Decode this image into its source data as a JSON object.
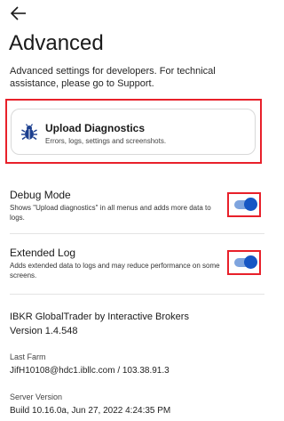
{
  "header": {
    "title": "Advanced",
    "subtitle": "Advanced settings for developers. For technical assistance, please go to Support."
  },
  "upload_card": {
    "title": "Upload Diagnostics",
    "description": "Errors, logs, settings and screenshots."
  },
  "settings": [
    {
      "title": "Debug Mode",
      "description": "Shows \"Upload diagnostics\" in all menus and adds more data to logs.",
      "enabled": true
    },
    {
      "title": "Extended Log",
      "description": "Adds extended data to logs and may reduce performance on some screens.",
      "enabled": true
    }
  ],
  "app_info": {
    "name": "IBKR GlobalTrader by Interactive Brokers",
    "version": "Version 1.4.548",
    "farm_label": "Last Farm",
    "farm_value": "JifH10108@hdc1.ibllc.com / 103.38.91.3",
    "server_label": "Server Version",
    "server_value": "Build 10.16.0a, Jun 27, 2022 4:24:35 PM"
  },
  "colors": {
    "toggle_on_knob": "#1656c4",
    "toggle_on_track": "#7ea4de",
    "highlight_box": "#e8202a",
    "icon_blue": "#1c3f8f"
  },
  "icons": {
    "back": "arrow-left-icon",
    "diagnostics": "bug-icon"
  }
}
